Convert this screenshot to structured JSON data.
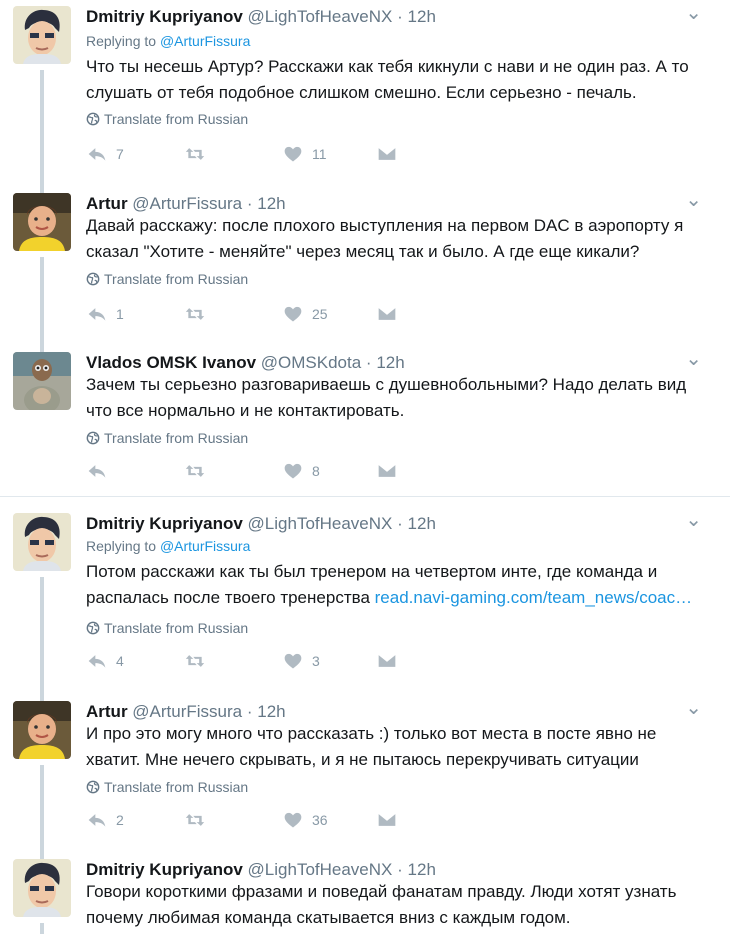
{
  "translate_label": "Translate from Russian",
  "tweets": [
    {
      "name": "Dmitriy Kupriyanov",
      "handle": "@LighTofHeaveNX",
      "time": "12h",
      "reply_prefix": "Replying to",
      "reply_to": "@ArturFissura",
      "text": "Что ты несешь Артур? Расскажи как тебя кикнули с нави и не один раз. А то слушать от тебя подобное слишком смешно. Если серьезно - печаль.",
      "replies": "7",
      "retweets": "",
      "likes": "11"
    },
    {
      "name": "Artur",
      "handle": "@ArturFissura",
      "time": "12h",
      "text": "Давай расскажу: после плохого выступления на первом DAC в аэропорту я сказал \"Хотите - меняйте\" через месяц так и было. А где еще кикали?",
      "replies": "1",
      "retweets": "",
      "likes": "25"
    },
    {
      "name": "Vlados OMSK Ivanov",
      "handle": "@OMSKdota",
      "time": "12h",
      "text": "Зачем ты серьезно разговариваешь с душевнобольными? Надо делать вид что все нормально и не контактировать.",
      "replies": "",
      "retweets": "",
      "likes": "8"
    },
    {
      "name": "Dmitriy Kupriyanov",
      "handle": "@LighTofHeaveNX",
      "time": "12h",
      "reply_prefix": "Replying to",
      "reply_to": "@ArturFissura",
      "text": "Потом расскажи как ты был тренером на четвертом инте, где команда и распалась после твоего тренерства ",
      "link": "read.navi-gaming.com/team_news/coac…",
      "replies": "4",
      "retweets": "",
      "likes": "3"
    },
    {
      "name": "Artur",
      "handle": "@ArturFissura",
      "time": "12h",
      "text": "И про это могу много что рассказать :) только вот места в посте  явно не хватит. Мне нечего скрывать, и я не пытаюсь перекручивать ситуации",
      "replies": "2",
      "retweets": "",
      "likes": "36"
    },
    {
      "name": "Dmitriy Kupriyanov",
      "handle": "@LighTofHeaveNX",
      "time": "12h",
      "text": "Говори короткими фразами и поведай фанатам правду. Люди хотят узнать почему любимая команда скатывается вниз с каждым годом."
    }
  ],
  "colors": {
    "link": "#1b95e0",
    "muted": "#657786",
    "line": "#ccd6dd"
  }
}
